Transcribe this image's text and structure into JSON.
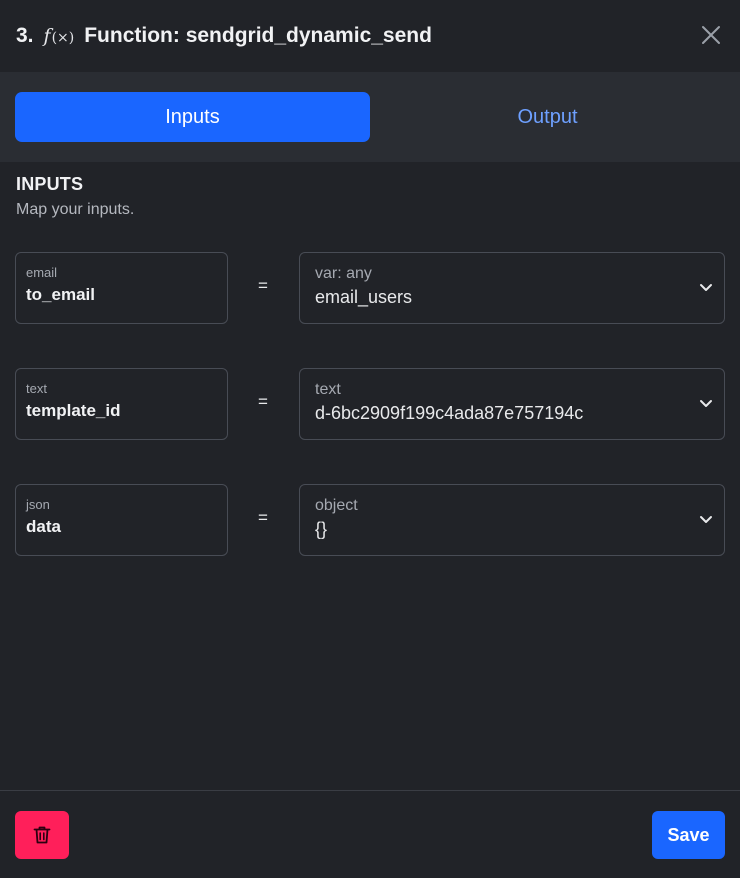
{
  "header": {
    "step_number": "3.",
    "fx_symbol": "f",
    "fx_parens": "(×)",
    "title": "Function: sendgrid_dynamic_send",
    "close_icon": "close-icon"
  },
  "tabs": [
    {
      "label": "Inputs",
      "active": true
    },
    {
      "label": "Output",
      "active": false
    }
  ],
  "section": {
    "title": "INPUTS",
    "subtitle": "Map your inputs."
  },
  "inputs": [
    {
      "type": "email",
      "name": "to_email",
      "equals": "=",
      "value_type": "var: any",
      "value": "email_users"
    },
    {
      "type": "text",
      "name": "template_id",
      "equals": "=",
      "value_type": "text",
      "value": "d-6bc2909f199c4ada87e757194c"
    },
    {
      "type": "json",
      "name": "data",
      "equals": "=",
      "value_type": "object",
      "value": "{}"
    }
  ],
  "footer": {
    "delete_icon": "trash-icon",
    "save_label": "Save"
  },
  "colors": {
    "background": "#212328",
    "tab_bar": "#2a2d33",
    "accent": "#1a66ff",
    "danger": "#ff1f5a",
    "border": "#484c55"
  }
}
